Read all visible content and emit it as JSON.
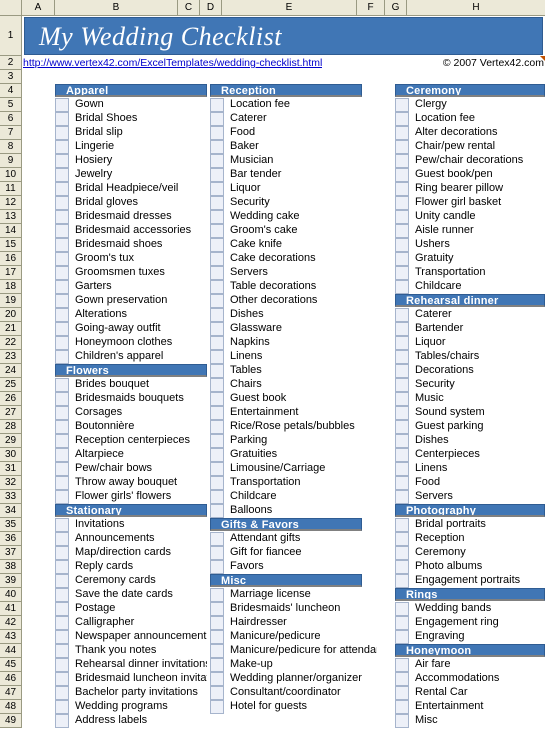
{
  "app": {
    "type": "spreadsheet",
    "title": "My Wedding Checklist",
    "url": "http://www.vertex42.com/ExcelTemplates/wedding-checklist.html",
    "copyright": "© 2007 Vertex42.com"
  },
  "colors": {
    "banner_blue": "#4076B5",
    "header_blue": "#4076B5",
    "checkbox_fill": "#EDF0F8",
    "checkbox_border": "#A6B4CC",
    "header_grey": "#ECE9D8",
    "link_blue": "#0000CC"
  },
  "column_headers": [
    "A",
    "B",
    "C",
    "D",
    "E",
    "F",
    "G",
    "H"
  ],
  "row_numbers": [
    1,
    2,
    3,
    4,
    5,
    6,
    7,
    8,
    9,
    10,
    11,
    12,
    13,
    14,
    15,
    16,
    17,
    18,
    19,
    20,
    21,
    22,
    23,
    24,
    25,
    26,
    27,
    28,
    29,
    30,
    31,
    32,
    33,
    34,
    35,
    36,
    37,
    38,
    39,
    40,
    41,
    42,
    43,
    44,
    45,
    46,
    47,
    48,
    49
  ],
  "columns": {
    "left": {
      "rows": [
        {
          "row": 4,
          "type": "header",
          "label": "Apparel"
        },
        {
          "row": 5,
          "type": "item",
          "label": "Gown"
        },
        {
          "row": 6,
          "type": "item",
          "label": "Bridal Shoes"
        },
        {
          "row": 7,
          "type": "item",
          "label": "Bridal slip"
        },
        {
          "row": 8,
          "type": "item",
          "label": "Lingerie"
        },
        {
          "row": 9,
          "type": "item",
          "label": "Hosiery"
        },
        {
          "row": 10,
          "type": "item",
          "label": "Jewelry"
        },
        {
          "row": 11,
          "type": "item",
          "label": "Bridal Headpiece/veil"
        },
        {
          "row": 12,
          "type": "item",
          "label": "Bridal gloves"
        },
        {
          "row": 13,
          "type": "item",
          "label": "Bridesmaid dresses"
        },
        {
          "row": 14,
          "type": "item",
          "label": "Bridesmaid accessories"
        },
        {
          "row": 15,
          "type": "item",
          "label": "Bridesmaid shoes"
        },
        {
          "row": 16,
          "type": "item",
          "label": "Groom's tux"
        },
        {
          "row": 17,
          "type": "item",
          "label": "Groomsmen tuxes"
        },
        {
          "row": 18,
          "type": "item",
          "label": "Garters"
        },
        {
          "row": 19,
          "type": "item",
          "label": "Gown preservation"
        },
        {
          "row": 20,
          "type": "item",
          "label": "Alterations"
        },
        {
          "row": 21,
          "type": "item",
          "label": "Going-away outfit"
        },
        {
          "row": 22,
          "type": "item",
          "label": "Honeymoon clothes"
        },
        {
          "row": 23,
          "type": "item",
          "label": "Children's apparel"
        },
        {
          "row": 24,
          "type": "header",
          "label": "Flowers"
        },
        {
          "row": 25,
          "type": "item",
          "label": "Brides bouquet"
        },
        {
          "row": 26,
          "type": "item",
          "label": "Bridesmaids bouquets"
        },
        {
          "row": 27,
          "type": "item",
          "label": "Corsages"
        },
        {
          "row": 28,
          "type": "item",
          "label": "Boutonnière"
        },
        {
          "row": 29,
          "type": "item",
          "label": "Reception centerpieces"
        },
        {
          "row": 30,
          "type": "item",
          "label": "Altarpiece"
        },
        {
          "row": 31,
          "type": "item",
          "label": "Pew/chair bows"
        },
        {
          "row": 32,
          "type": "item",
          "label": "Throw away bouquet"
        },
        {
          "row": 33,
          "type": "item",
          "label": "Flower girls' flowers"
        },
        {
          "row": 34,
          "type": "header",
          "label": "Stationary"
        },
        {
          "row": 35,
          "type": "item",
          "label": "Invitations"
        },
        {
          "row": 36,
          "type": "item",
          "label": "Announcements"
        },
        {
          "row": 37,
          "type": "item",
          "label": "Map/direction cards"
        },
        {
          "row": 38,
          "type": "item",
          "label": "Reply cards"
        },
        {
          "row": 39,
          "type": "item",
          "label": "Ceremony cards"
        },
        {
          "row": 40,
          "type": "item",
          "label": "Save the date cards"
        },
        {
          "row": 41,
          "type": "item",
          "label": "Postage"
        },
        {
          "row": 42,
          "type": "item",
          "label": "Calligrapher"
        },
        {
          "row": 43,
          "type": "item",
          "label": "Newspaper announcement"
        },
        {
          "row": 44,
          "type": "item",
          "label": "Thank you notes"
        },
        {
          "row": 45,
          "type": "item",
          "label": "Rehearsal dinner invitations"
        },
        {
          "row": 46,
          "type": "item",
          "label": "Bridesmaid luncheon invitations"
        },
        {
          "row": 47,
          "type": "item",
          "label": "Bachelor party invitations"
        },
        {
          "row": 48,
          "type": "item",
          "label": "Wedding programs"
        },
        {
          "row": 49,
          "type": "item",
          "label": "Address labels"
        }
      ]
    },
    "middle": {
      "rows": [
        {
          "row": 4,
          "type": "header",
          "label": "Reception"
        },
        {
          "row": 5,
          "type": "item",
          "label": "Location fee"
        },
        {
          "row": 6,
          "type": "item",
          "label": "Caterer"
        },
        {
          "row": 7,
          "type": "item",
          "label": "Food"
        },
        {
          "row": 8,
          "type": "item",
          "label": "Baker"
        },
        {
          "row": 9,
          "type": "item",
          "label": "Musician"
        },
        {
          "row": 10,
          "type": "item",
          "label": "Bar tender"
        },
        {
          "row": 11,
          "type": "item",
          "label": "Liquor"
        },
        {
          "row": 12,
          "type": "item",
          "label": "Security"
        },
        {
          "row": 13,
          "type": "item",
          "label": "Wedding cake"
        },
        {
          "row": 14,
          "type": "item",
          "label": "Groom's cake"
        },
        {
          "row": 15,
          "type": "item",
          "label": "Cake knife"
        },
        {
          "row": 16,
          "type": "item",
          "label": "Cake decorations"
        },
        {
          "row": 17,
          "type": "item",
          "label": "Servers"
        },
        {
          "row": 18,
          "type": "item",
          "label": "Table decorations"
        },
        {
          "row": 19,
          "type": "item",
          "label": "Other decorations"
        },
        {
          "row": 20,
          "type": "item",
          "label": "Dishes"
        },
        {
          "row": 21,
          "type": "item",
          "label": "Glassware"
        },
        {
          "row": 22,
          "type": "item",
          "label": "Napkins"
        },
        {
          "row": 23,
          "type": "item",
          "label": "Linens"
        },
        {
          "row": 24,
          "type": "item",
          "label": "Tables"
        },
        {
          "row": 25,
          "type": "item",
          "label": "Chairs"
        },
        {
          "row": 26,
          "type": "item",
          "label": "Guest book"
        },
        {
          "row": 27,
          "type": "item",
          "label": "Entertainment"
        },
        {
          "row": 28,
          "type": "item",
          "label": "Rice/Rose petals/bubbles"
        },
        {
          "row": 29,
          "type": "item",
          "label": "Parking"
        },
        {
          "row": 30,
          "type": "item",
          "label": "Gratuities"
        },
        {
          "row": 31,
          "type": "item",
          "label": "Limousine/Carriage"
        },
        {
          "row": 32,
          "type": "item",
          "label": "Transportation"
        },
        {
          "row": 33,
          "type": "item",
          "label": "Childcare"
        },
        {
          "row": 34,
          "type": "item",
          "label": "Balloons"
        },
        {
          "row": 35,
          "type": "header",
          "label": "Gifts & Favors"
        },
        {
          "row": 36,
          "type": "item",
          "label": "Attendant gifts"
        },
        {
          "row": 37,
          "type": "item",
          "label": "Gift for fiancee"
        },
        {
          "row": 38,
          "type": "item",
          "label": "Favors"
        },
        {
          "row": 39,
          "type": "header",
          "label": "Misc"
        },
        {
          "row": 40,
          "type": "item",
          "label": "Marriage license"
        },
        {
          "row": 41,
          "type": "item",
          "label": "Bridesmaids' luncheon"
        },
        {
          "row": 42,
          "type": "item",
          "label": "Hairdresser"
        },
        {
          "row": 43,
          "type": "item",
          "label": "Manicure/pedicure"
        },
        {
          "row": 44,
          "type": "item",
          "label": "Manicure/pedicure for attendants"
        },
        {
          "row": 45,
          "type": "item",
          "label": "Make-up"
        },
        {
          "row": 46,
          "type": "item",
          "label": "Wedding planner/organizer"
        },
        {
          "row": 47,
          "type": "item",
          "label": "Consultant/coordinator"
        },
        {
          "row": 48,
          "type": "item",
          "label": "Hotel for guests"
        },
        {
          "row": 49,
          "type": "blank",
          "label": ""
        }
      ]
    },
    "right": {
      "rows": [
        {
          "row": 4,
          "type": "header",
          "label": "Ceremony"
        },
        {
          "row": 5,
          "type": "item",
          "label": "Clergy"
        },
        {
          "row": 6,
          "type": "item",
          "label": "Location fee"
        },
        {
          "row": 7,
          "type": "item",
          "label": "Alter decorations"
        },
        {
          "row": 8,
          "type": "item",
          "label": "Chair/pew rental"
        },
        {
          "row": 9,
          "type": "item",
          "label": "Pew/chair decorations"
        },
        {
          "row": 10,
          "type": "item",
          "label": "Guest book/pen"
        },
        {
          "row": 11,
          "type": "item",
          "label": "Ring bearer pillow"
        },
        {
          "row": 12,
          "type": "item",
          "label": "Flower girl basket"
        },
        {
          "row": 13,
          "type": "item",
          "label": "Unity candle"
        },
        {
          "row": 14,
          "type": "item",
          "label": "Aisle runner"
        },
        {
          "row": 15,
          "type": "item",
          "label": "Ushers"
        },
        {
          "row": 16,
          "type": "item",
          "label": "Gratuity"
        },
        {
          "row": 17,
          "type": "item",
          "label": "Transportation"
        },
        {
          "row": 18,
          "type": "item",
          "label": "Childcare"
        },
        {
          "row": 19,
          "type": "header",
          "label": "Rehearsal dinner"
        },
        {
          "row": 20,
          "type": "item",
          "label": "Caterer"
        },
        {
          "row": 21,
          "type": "item",
          "label": "Bartender"
        },
        {
          "row": 22,
          "type": "item",
          "label": "Liquor"
        },
        {
          "row": 23,
          "type": "item",
          "label": "Tables/chairs"
        },
        {
          "row": 24,
          "type": "item",
          "label": "Decorations"
        },
        {
          "row": 25,
          "type": "item",
          "label": "Security"
        },
        {
          "row": 26,
          "type": "item",
          "label": "Music"
        },
        {
          "row": 27,
          "type": "item",
          "label": "Sound system"
        },
        {
          "row": 28,
          "type": "item",
          "label": "Guest parking"
        },
        {
          "row": 29,
          "type": "item",
          "label": "Dishes"
        },
        {
          "row": 30,
          "type": "item",
          "label": "Centerpieces"
        },
        {
          "row": 31,
          "type": "item",
          "label": "Linens"
        },
        {
          "row": 32,
          "type": "item",
          "label": "Food"
        },
        {
          "row": 33,
          "type": "item",
          "label": "Servers"
        },
        {
          "row": 34,
          "type": "header",
          "label": "Photography"
        },
        {
          "row": 35,
          "type": "item",
          "label": "Bridal portraits"
        },
        {
          "row": 36,
          "type": "item",
          "label": "Reception"
        },
        {
          "row": 37,
          "type": "item",
          "label": "Ceremony"
        },
        {
          "row": 38,
          "type": "item",
          "label": "Photo albums"
        },
        {
          "row": 39,
          "type": "item",
          "label": "Engagement portraits"
        },
        {
          "row": 40,
          "type": "header",
          "label": "Rings"
        },
        {
          "row": 41,
          "type": "item",
          "label": "Wedding bands"
        },
        {
          "row": 42,
          "type": "item",
          "label": "Engagement ring"
        },
        {
          "row": 43,
          "type": "item",
          "label": "Engraving"
        },
        {
          "row": 44,
          "type": "header",
          "label": "Honeymoon"
        },
        {
          "row": 45,
          "type": "item",
          "label": "Air fare"
        },
        {
          "row": 46,
          "type": "item",
          "label": "Accommodations"
        },
        {
          "row": 47,
          "type": "item",
          "label": "Rental Car"
        },
        {
          "row": 48,
          "type": "item",
          "label": "Entertainment"
        },
        {
          "row": 49,
          "type": "item",
          "label": "Misc"
        }
      ]
    }
  }
}
